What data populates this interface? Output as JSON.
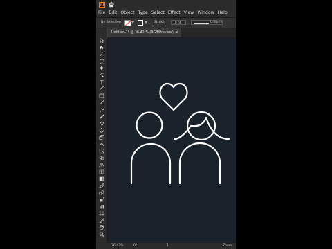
{
  "app": {
    "logo_text": "Ai"
  },
  "menu": [
    "File",
    "Edit",
    "Object",
    "Type",
    "Select",
    "Effect",
    "View",
    "Window",
    "Help"
  ],
  "control_bar": {
    "selection_label": "No Selection",
    "stroke_label": "Stroke:",
    "stroke_weight": "10 pt",
    "profile_label": "Uniform"
  },
  "document": {
    "tab_title": "Untitled-1* @ 26.42 % (RGB/Preview)"
  },
  "tools": [
    "selection-icon",
    "direct-selection-icon",
    "magic-wand-icon",
    "lasso-icon",
    "pen-icon",
    "curvature-icon",
    "type-icon",
    "line-segment-icon",
    "rectangle-icon",
    "paintbrush-icon",
    "shaper-icon",
    "pencil-icon",
    "eraser-icon",
    "rotate-icon",
    "scale-icon",
    "width-icon",
    "free-transform-icon",
    "shape-builder-icon",
    "perspective-grid-icon",
    "mesh-icon",
    "gradient-icon",
    "eyedropper-icon",
    "blend-icon",
    "symbol-sprayer-icon",
    "column-graph-icon",
    "artboard-icon",
    "slice-icon",
    "hand-icon",
    "zoom-icon"
  ],
  "status_bar": {
    "zoom": "26.42%",
    "rotation": "0°",
    "artboard": "1",
    "mode": "Zoom"
  },
  "colors": {
    "canvas": "#1a222b",
    "artwork_stroke": "#ffffff",
    "app_bg": "#1e1e1e"
  }
}
